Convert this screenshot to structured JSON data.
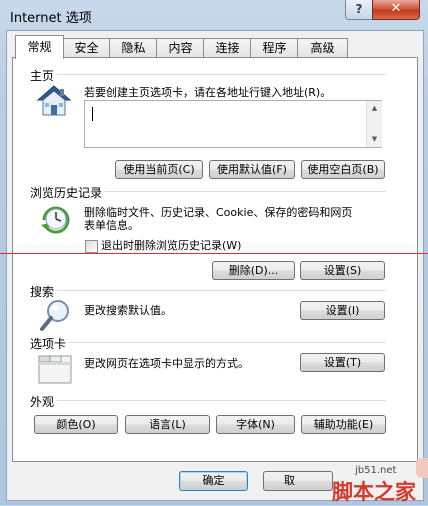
{
  "window": {
    "title": "Internet 选项",
    "help_label": "?",
    "close_label": "✕"
  },
  "tabs": [
    {
      "label": "常规",
      "active": true
    },
    {
      "label": "安全"
    },
    {
      "label": "隐私"
    },
    {
      "label": "内容"
    },
    {
      "label": "连接"
    },
    {
      "label": "程序"
    },
    {
      "label": "高级"
    }
  ],
  "home": {
    "section_label": "主页",
    "icon": "house-icon",
    "description": "若要创建主页选项卡，请在各地址行键入地址(R)。",
    "address_value": "",
    "buttons": {
      "use_current": "使用当前页(C)",
      "use_default": "使用默认值(F)",
      "use_blank": "使用空白页(B)"
    }
  },
  "history": {
    "section_label": "浏览历史记录",
    "icon": "clock-history-icon",
    "description_line1": "删除临时文件、历史记录、Cookie、保存的密码和网页",
    "description_line2": "表单信息。",
    "checkbox_label": "退出时删除浏览历史记录(W)",
    "checkbox_checked": false,
    "delete_label": "删除(D)...",
    "settings_label": "设置(S)"
  },
  "search": {
    "section_label": "搜索",
    "icon": "magnifier-icon",
    "description": "更改搜索默认值。",
    "settings_label": "设置(I)"
  },
  "tabs_section": {
    "section_label": "选项卡",
    "icon": "tabs-window-icon",
    "description": "更改网页在选项卡中显示的方式。",
    "settings_label": "设置(T)"
  },
  "appearance": {
    "section_label": "外观",
    "colors_label": "颜色(O)",
    "languages_label": "语言(L)",
    "fonts_label": "字体(N)",
    "accessibility_label": "辅助功能(E)"
  },
  "footer": {
    "ok_label": "确定",
    "cancel_label": "取"
  },
  "watermark": {
    "site": "jb51.net",
    "brand": "脚本之家"
  }
}
